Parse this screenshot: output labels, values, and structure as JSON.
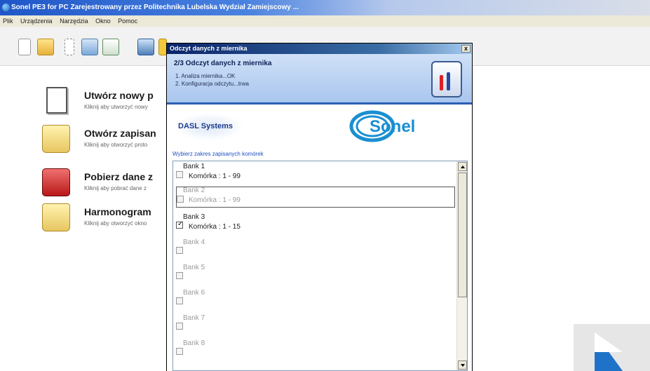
{
  "app": {
    "title": "Sonel PE3 for PC  Zarejestrowany przez  Politechnika Lubelska Wydział Zamiejscowy ...",
    "menu": [
      "Plik",
      "Urządzenia",
      "Narzędzia",
      "Okno",
      "Pomoc"
    ]
  },
  "toolbar_icons": [
    "new-file-icon",
    "open-folder-icon",
    "cut-icon",
    "database-icon",
    "chart-icon",
    "monitor-icon",
    "yellow-icon"
  ],
  "workspace": {
    "items": [
      {
        "title": "Utwórz nowy p",
        "desc": "Kliknij aby utworzyć nowy",
        "icon": "new-document-icon"
      },
      {
        "title": "Otwórz zapisan",
        "desc": "Kliknij aby otworzyć proto",
        "icon": "open-folder-icon"
      },
      {
        "title": "Pobierz dane z",
        "desc": "Kliknij aby pobrać dane z",
        "icon": "meter-download-icon"
      },
      {
        "title": "Harmonogram",
        "desc": "Kliknij aby otworzyć okno",
        "icon": "schedule-folder-icon"
      }
    ]
  },
  "dialog": {
    "title": "Odczyt danych z miernika",
    "close_label": "x",
    "step": "2/3 Odczyt danych z miernika",
    "steps": [
      "1. Analiza miernika...OK",
      "2. Konfiguracja odczytu...trwa"
    ],
    "dasl_logo": "DASL Systems",
    "sonel_logo": "Sonel",
    "prompt": "Wybierz zakres zapisanych komórek",
    "banks": [
      {
        "name": "Bank 1",
        "cells": "Komórka : 1 - 99",
        "checked": false,
        "enabled": true
      },
      {
        "name": "Bank 2",
        "cells": "Komórka : 1 - 99",
        "checked": false,
        "enabled": false
      },
      {
        "name": "Bank 3",
        "cells": "Komórka : 1 - 15",
        "checked": true,
        "enabled": true
      },
      {
        "name": "Bank 4",
        "cells": "",
        "checked": false,
        "enabled": false
      },
      {
        "name": "Bank 5",
        "cells": "",
        "checked": false,
        "enabled": false
      },
      {
        "name": "Bank 6",
        "cells": "",
        "checked": false,
        "enabled": false
      },
      {
        "name": "Bank 7",
        "cells": "",
        "checked": false,
        "enabled": false
      },
      {
        "name": "Bank 8",
        "cells": "",
        "checked": false,
        "enabled": false
      }
    ]
  },
  "colors": {
    "title_blue": "#1f56c8",
    "header_blue": "#a9c6ee",
    "sonel_blue": "#1a8fd1",
    "prompt_blue": "#2050c0"
  }
}
